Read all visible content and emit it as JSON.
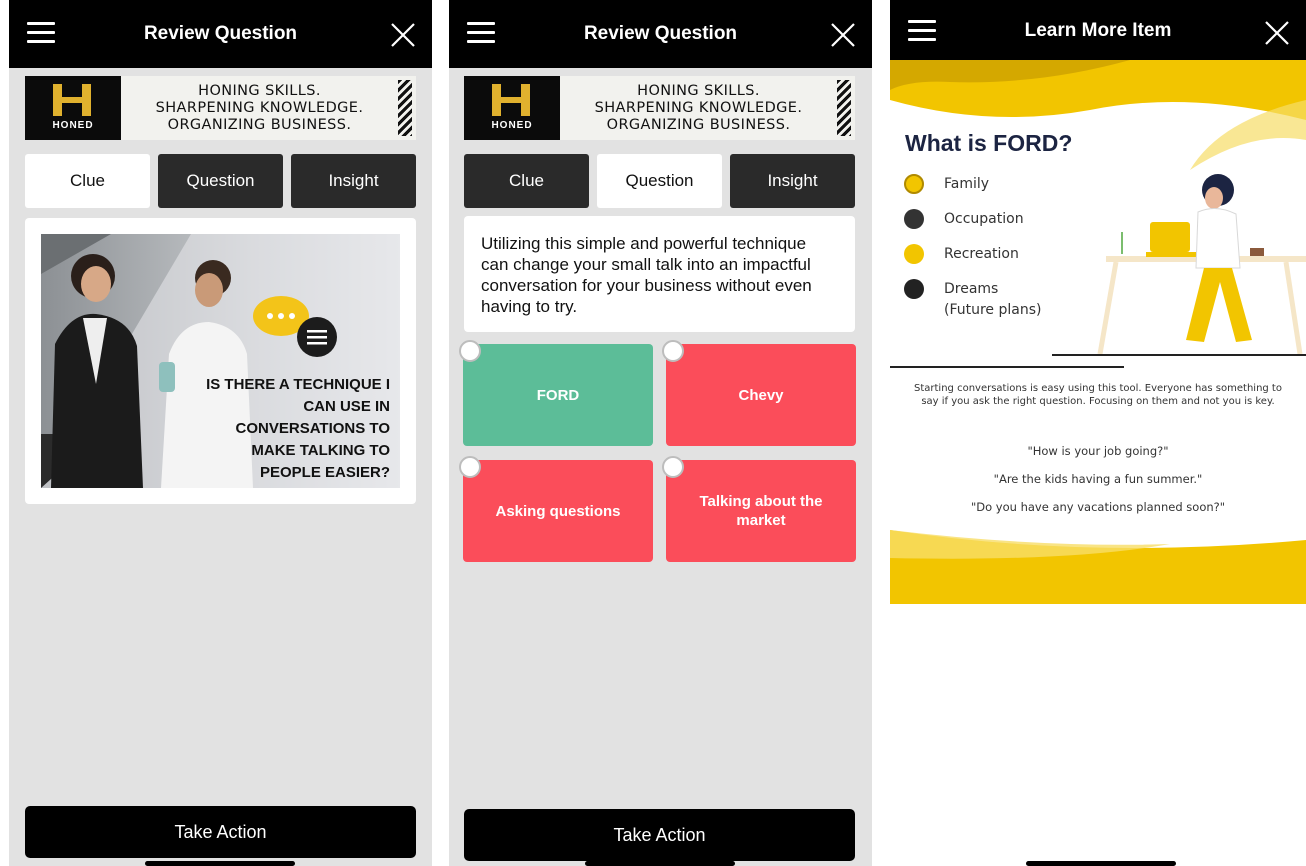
{
  "screens": {
    "clue": {
      "title": "Review Question",
      "banner": {
        "logo_text": "HONED",
        "slogan": [
          "HONING SKILLS.",
          "SHARPENING KNOWLEDGE.",
          "ORGANIZING BUSINESS."
        ]
      },
      "tabs": [
        "Clue",
        "Question",
        "Insight"
      ],
      "active_tab": "Clue",
      "image_text": [
        "IS THERE A TECHNIQUE I",
        "CAN USE IN",
        "CONVERSATIONS TO",
        "MAKE TALKING TO",
        "PEOPLE EASIER?"
      ],
      "action_label": "Take Action"
    },
    "question": {
      "title": "Review Question",
      "tabs": [
        "Clue",
        "Question",
        "Insight"
      ],
      "active_tab": "Question",
      "question_text": "Utilizing this simple and powerful technique can change your small talk into an impactful conversation for your business without even having to try.",
      "answers": [
        {
          "label": "FORD",
          "color": "#5cbd98"
        },
        {
          "label": "Chevy",
          "color": "#fb4d5a"
        },
        {
          "label": "Asking questions",
          "color": "#fb4d5a"
        },
        {
          "label": "Talking about the market",
          "color": "#fb4d5a"
        }
      ],
      "action_label": "Take Action"
    },
    "learn_more": {
      "title": "Learn More Item",
      "heading": "What is FORD?",
      "items": [
        {
          "label": "Family",
          "icon": "family-icon"
        },
        {
          "label": "Occupation",
          "icon": "occupation-icon"
        },
        {
          "label": "Recreation",
          "icon": "recreation-icon"
        },
        {
          "label": "Dreams",
          "sublabel": "(Future plans)",
          "icon": "dreams-icon"
        }
      ],
      "body": "Starting conversations is easy using this tool. Everyone has something to say if you ask the right question. Focusing on them and not you is key.",
      "quotes": [
        "\"How is your job going?\"",
        "\"Are the kids having a fun summer.\"",
        "\"Do you have any vacations planned soon?\""
      ]
    }
  },
  "colors": {
    "brand_yellow": "#f2c500",
    "correct": "#5cbd98",
    "wrong": "#fb4d5a",
    "dark": "#2a2a2a"
  }
}
